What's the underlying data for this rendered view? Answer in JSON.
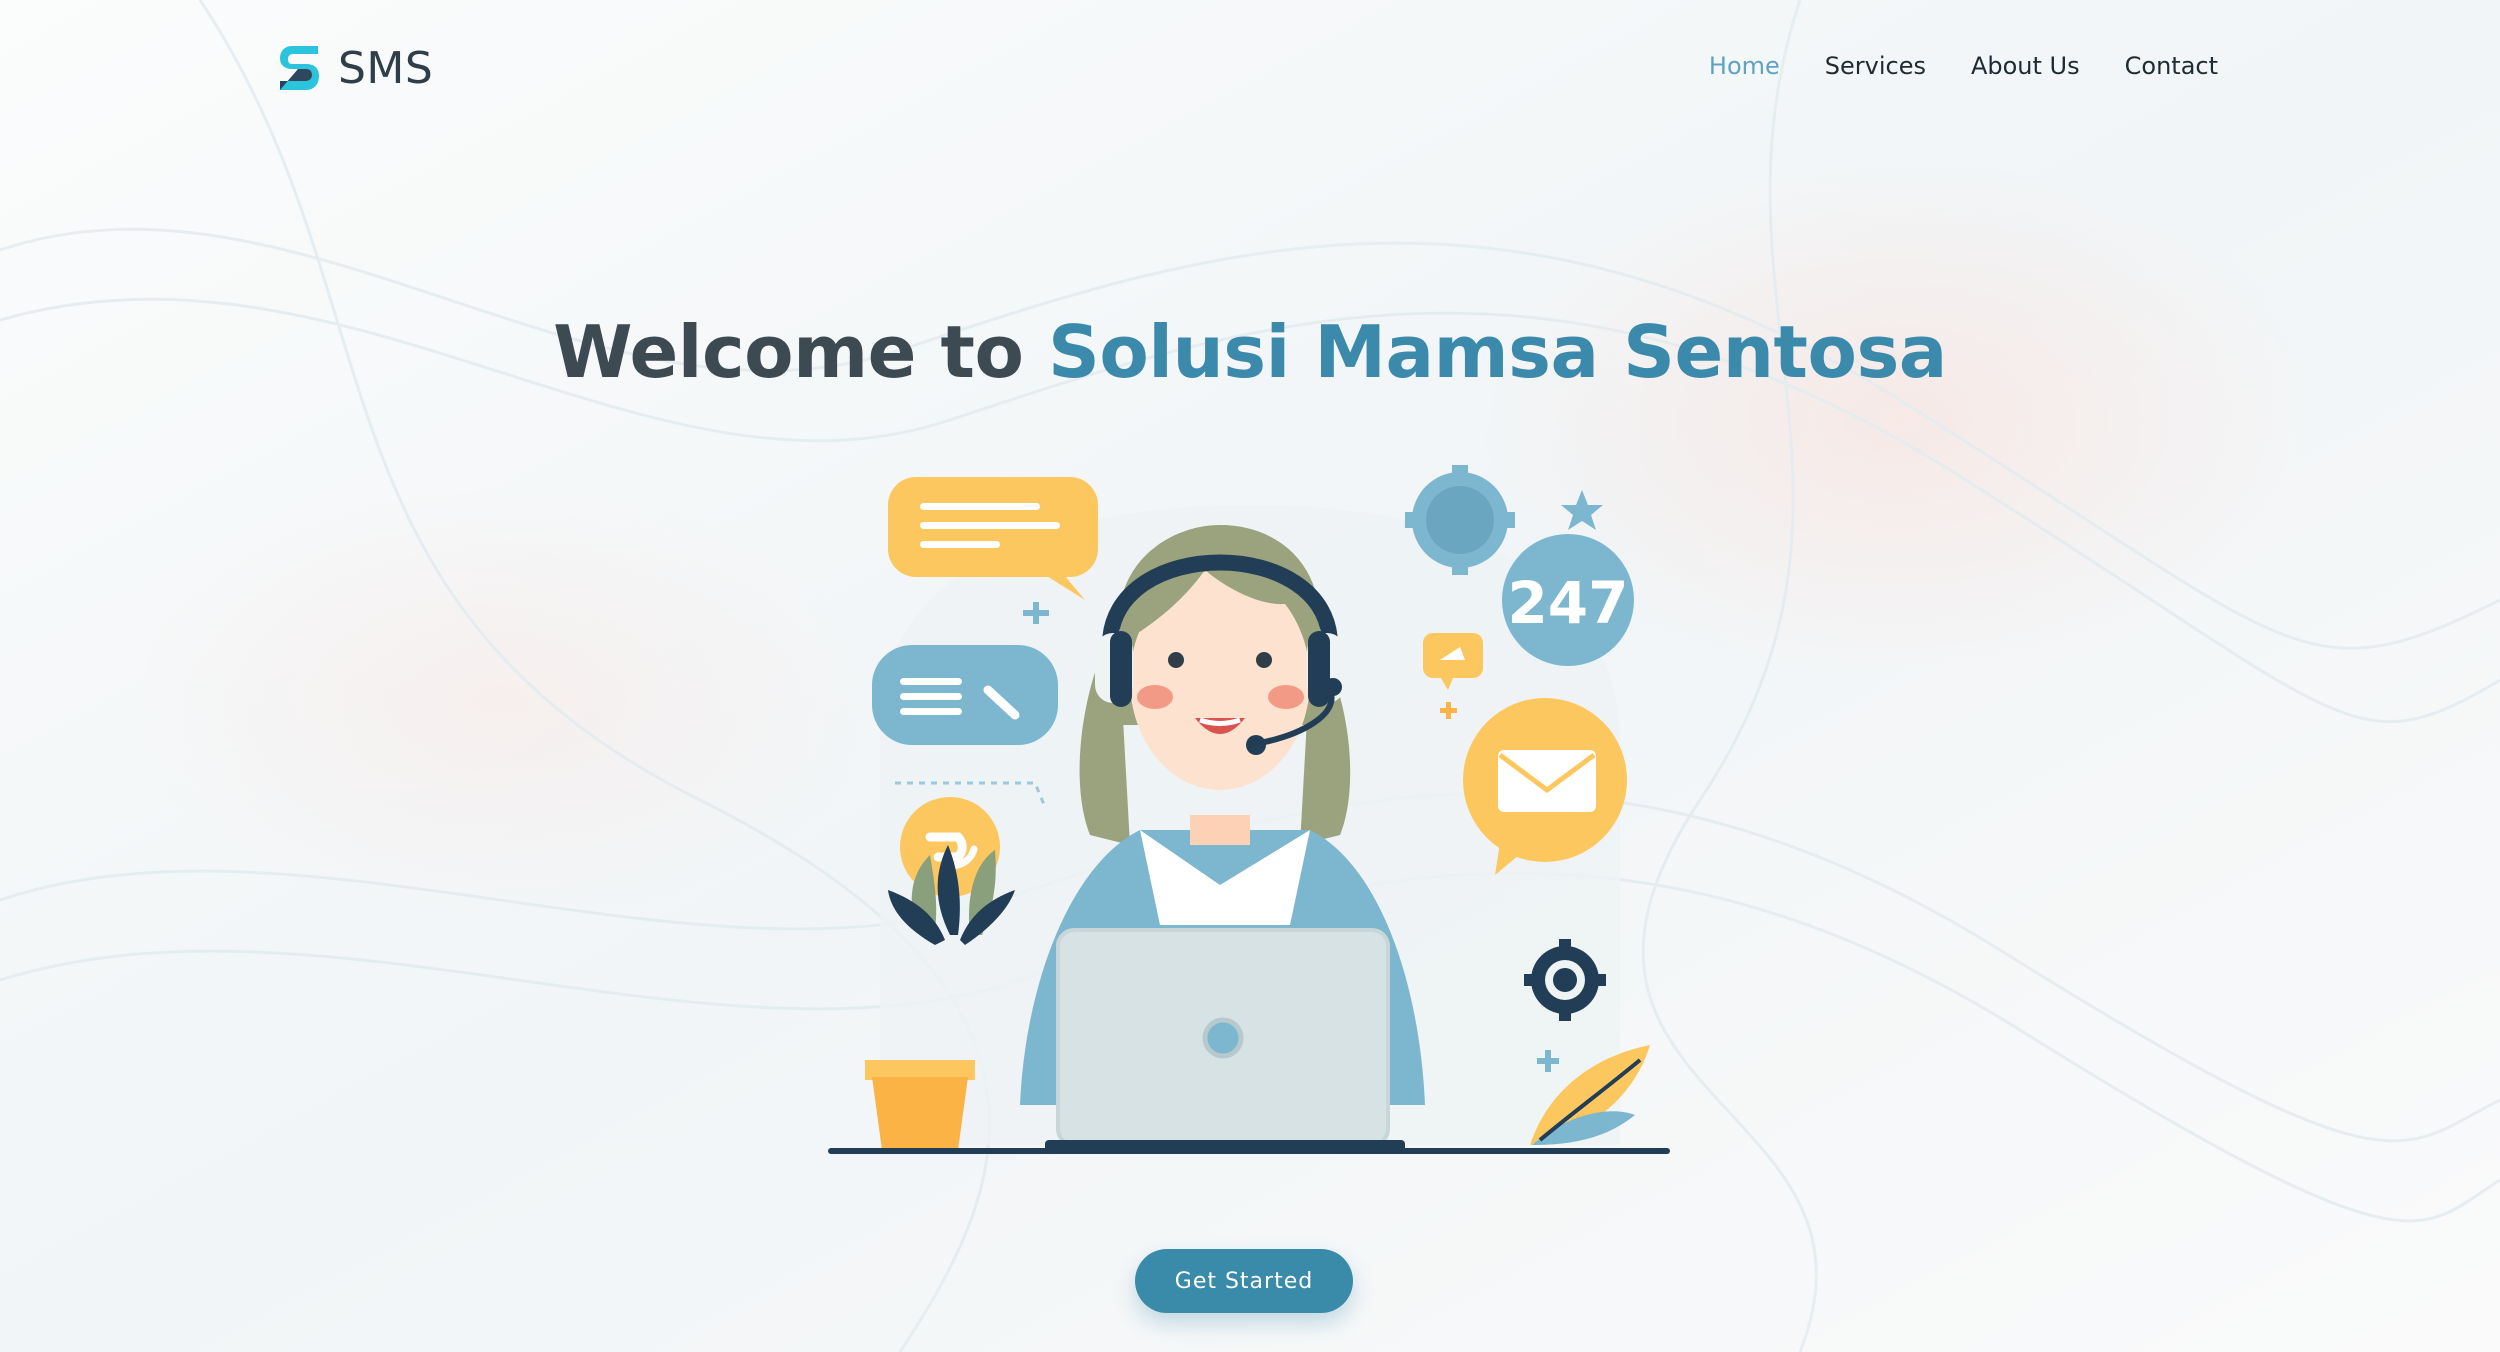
{
  "brand": {
    "name": "SMS",
    "icon": "sms-logo-icon",
    "colors": {
      "primary": "#3a8aaa",
      "cyan": "#2cc3dc",
      "navy": "#223d56"
    }
  },
  "nav": {
    "items": [
      {
        "label": "Home",
        "active": true
      },
      {
        "label": "Services",
        "active": false
      },
      {
        "label": "About Us",
        "active": false
      },
      {
        "label": "Contact",
        "active": false
      }
    ]
  },
  "hero": {
    "title_prefix": "Welcome to ",
    "title_accent": "Solusi Mamsa Sentosa",
    "cta_label": "Get Started",
    "illustration": {
      "description_icons": [
        "chat-bubble-icon",
        "headset-agent-icon",
        "gear-icon",
        "star-icon",
        "mail-icon",
        "laptop-icon",
        "plant-icon",
        "refresh-icon"
      ],
      "badge_text": "247"
    }
  }
}
